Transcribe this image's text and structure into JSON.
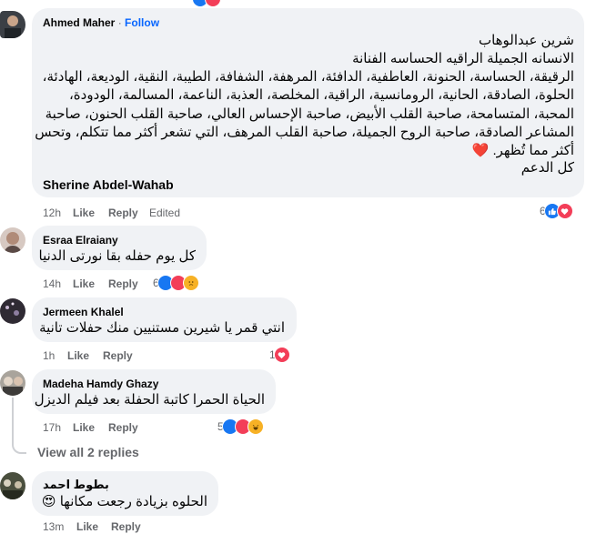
{
  "comments": [
    {
      "author": "Ahmed Maher",
      "follow_sep": "·",
      "follow": "Follow",
      "lines": [
        "شرين عبدالوهاب",
        "الانسانه الجميلة الراقيه الحساسه الفنانة",
        "الرقيقة، الحساسة، الحنونة، العاطفية، الدافئة، المرهفة، الشفافة، الطيبة، النقية، الوديعة، الهادئة،",
        "الحلوة، الصادقة، الحانية، الرومانسية، الراقية، المخلصة، العذبة، الناعمة، المسالمة، الودودة،",
        "المحبة، المتسامحة، صاحبة القلب الأبيض، صاحبة الإحساس العالي، صاحبة القلب الحنون، صاحبة",
        "المشاعر الصادقة، صاحبة الروح الجميلة، صاحبة القلب المرهف، التي تشعر أكثر مما تتكلم، وتحس",
        "أكثر مما تُظهر. ❤️",
        "كل الدعم"
      ],
      "signature": "Sherine Abdel-Wahab",
      "time": "12h",
      "like": "Like",
      "reply": "Reply",
      "edited": "Edited",
      "reaction_count": "6"
    },
    {
      "author": "Esraa Elraiany",
      "text": "كل يوم حفله بقا نورتى الدنيا",
      "time": "14h",
      "like": "Like",
      "reply": "Reply",
      "reaction_count": "6"
    },
    {
      "author": "Jermeen Khalel",
      "text": "انتي قمر يا شيرين مستنيين منك حفلات تانية",
      "time": "1h",
      "like": "Like",
      "reply": "Reply",
      "reaction_count": "1"
    },
    {
      "author": "Madeha Hamdy Ghazy",
      "text": "الحياة الحمرا كاتبة الحفلة بعد فيلم الديزل",
      "time": "17h",
      "like": "Like",
      "reply": "Reply",
      "reaction_count": "5"
    },
    {
      "author": "بطوط احمد",
      "text": "الحلوه بزيادة رجعت مكانها 😍",
      "time": "13m",
      "like": "Like",
      "reply": "Reply"
    }
  ],
  "view_all_replies": "View all 2 replies",
  "colors": {
    "like": "#1877f2",
    "love": "#f33e58",
    "emoji": "#f7b125",
    "bubble": "#f0f2f5",
    "link": "#0866ff"
  },
  "reaction_icons": [
    "like-icon",
    "love-icon",
    "sad-icon",
    "haha-icon"
  ]
}
